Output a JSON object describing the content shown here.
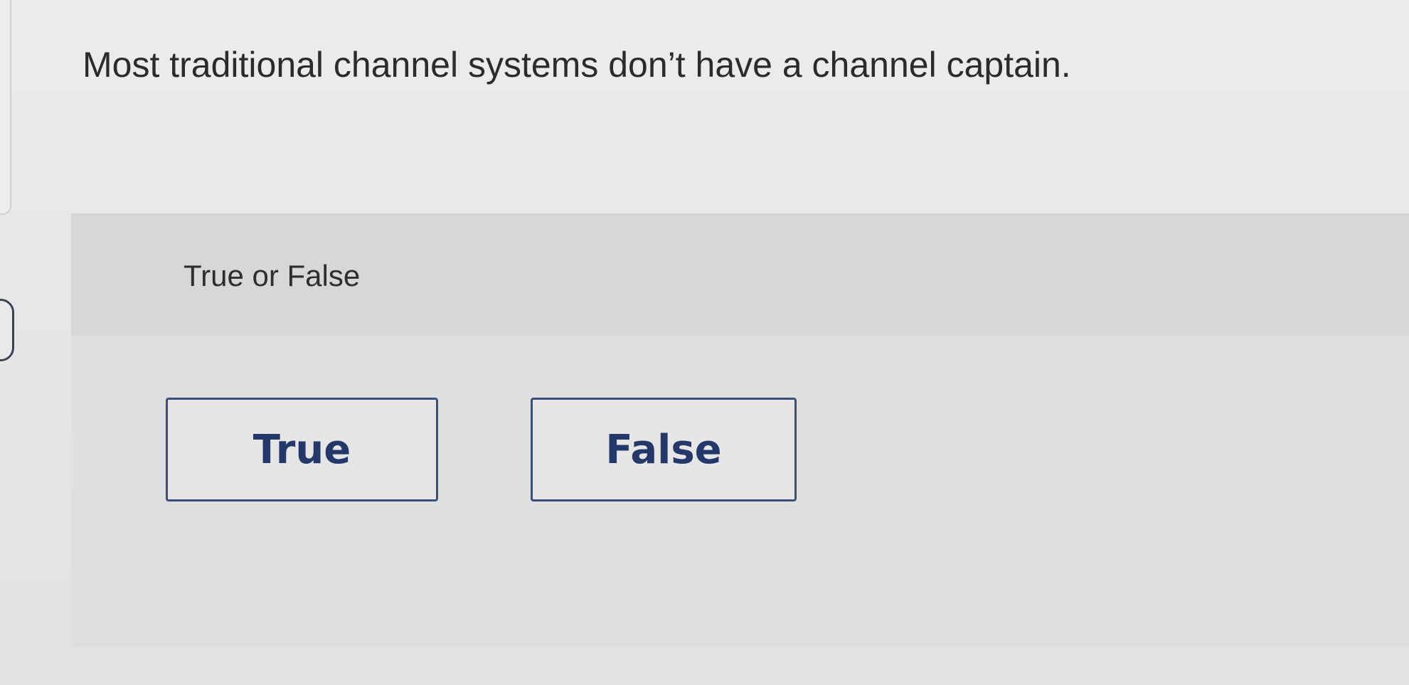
{
  "question": {
    "text": "Most traditional channel systems don’t have a channel captain."
  },
  "answer_area": {
    "prompt": "True or False",
    "choices": [
      {
        "label": "True"
      },
      {
        "label": "False"
      }
    ]
  },
  "colors": {
    "choice_border": "#3b4f7a",
    "choice_text": "#24386a",
    "question_text": "#2b2b2b",
    "panel_background": "#dfdfdf"
  }
}
